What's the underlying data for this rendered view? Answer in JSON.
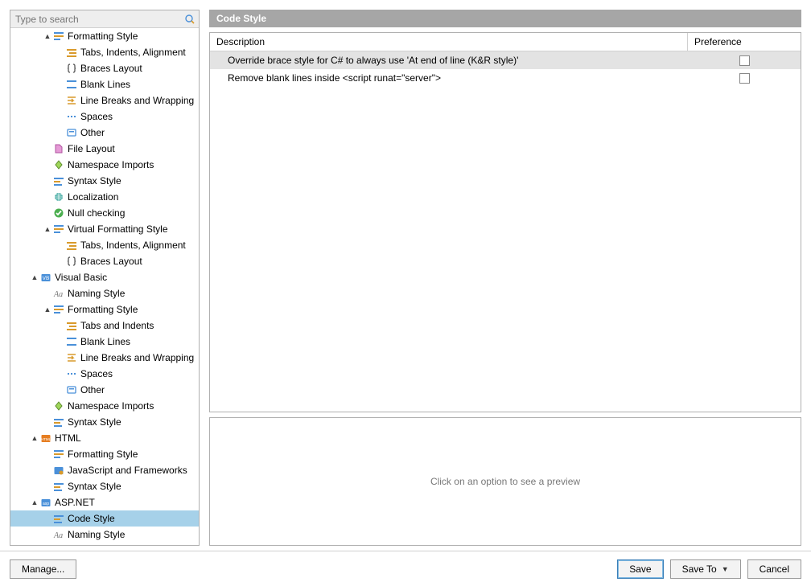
{
  "search": {
    "placeholder": "Type to search"
  },
  "tree": {
    "items": [
      {
        "depth": 2,
        "caret": "▲",
        "icon": "formattingstyle",
        "label": "Formatting Style"
      },
      {
        "depth": 3,
        "caret": "",
        "icon": "tabs",
        "label": "Tabs, Indents, Alignment"
      },
      {
        "depth": 3,
        "caret": "",
        "icon": "braces",
        "label": "Braces Layout"
      },
      {
        "depth": 3,
        "caret": "",
        "icon": "blanklines",
        "label": "Blank Lines"
      },
      {
        "depth": 3,
        "caret": "",
        "icon": "linebreaks",
        "label": "Line Breaks and Wrapping"
      },
      {
        "depth": 3,
        "caret": "",
        "icon": "spaces",
        "label": "Spaces"
      },
      {
        "depth": 3,
        "caret": "",
        "icon": "other",
        "label": "Other"
      },
      {
        "depth": 2,
        "caret": "",
        "icon": "filelayout",
        "label": "File Layout"
      },
      {
        "depth": 2,
        "caret": "",
        "icon": "namespace",
        "label": "Namespace Imports"
      },
      {
        "depth": 2,
        "caret": "",
        "icon": "syntaxstyle",
        "label": "Syntax Style"
      },
      {
        "depth": 2,
        "caret": "",
        "icon": "localization",
        "label": "Localization"
      },
      {
        "depth": 2,
        "caret": "",
        "icon": "nullcheck",
        "label": "Null checking"
      },
      {
        "depth": 2,
        "caret": "▲",
        "icon": "formattingstyle",
        "label": "Virtual Formatting Style"
      },
      {
        "depth": 3,
        "caret": "",
        "icon": "tabs",
        "label": "Tabs, Indents, Alignment"
      },
      {
        "depth": 3,
        "caret": "",
        "icon": "braces",
        "label": "Braces Layout"
      },
      {
        "depth": 1,
        "caret": "▲",
        "icon": "visualbasic",
        "label": "Visual Basic"
      },
      {
        "depth": 2,
        "caret": "",
        "icon": "naming",
        "label": "Naming Style"
      },
      {
        "depth": 2,
        "caret": "▲",
        "icon": "formattingstyle",
        "label": "Formatting Style"
      },
      {
        "depth": 3,
        "caret": "",
        "icon": "tabs",
        "label": "Tabs and Indents"
      },
      {
        "depth": 3,
        "caret": "",
        "icon": "blanklines",
        "label": "Blank Lines"
      },
      {
        "depth": 3,
        "caret": "",
        "icon": "linebreaks",
        "label": "Line Breaks and Wrapping"
      },
      {
        "depth": 3,
        "caret": "",
        "icon": "spaces",
        "label": "Spaces"
      },
      {
        "depth": 3,
        "caret": "",
        "icon": "other",
        "label": "Other"
      },
      {
        "depth": 2,
        "caret": "",
        "icon": "namespace",
        "label": "Namespace Imports"
      },
      {
        "depth": 2,
        "caret": "",
        "icon": "syntaxstyle",
        "label": "Syntax Style"
      },
      {
        "depth": 1,
        "caret": "▲",
        "icon": "html",
        "label": "HTML"
      },
      {
        "depth": 2,
        "caret": "",
        "icon": "formattingstyle",
        "label": "Formatting Style"
      },
      {
        "depth": 2,
        "caret": "",
        "icon": "jsframeworks",
        "label": "JavaScript and Frameworks"
      },
      {
        "depth": 2,
        "caret": "",
        "icon": "syntaxstyle",
        "label": "Syntax Style"
      },
      {
        "depth": 1,
        "caret": "▲",
        "icon": "aspnet",
        "label": "ASP.NET"
      },
      {
        "depth": 2,
        "caret": "",
        "icon": "codestyle",
        "label": "Code Style",
        "selected": true
      },
      {
        "depth": 2,
        "caret": "",
        "icon": "naming",
        "label": "Naming Style"
      }
    ]
  },
  "panel": {
    "title": "Code Style",
    "columns": {
      "description": "Description",
      "preference": "Preference"
    },
    "rows": [
      {
        "desc": "Override brace style for C# to always use 'At end of line (K&R style)'",
        "selected": true
      },
      {
        "desc": "Remove blank lines inside <script runat=\"server\">"
      }
    ],
    "preview_placeholder": "Click on an option to see a preview"
  },
  "footer": {
    "manage": "Manage...",
    "save": "Save",
    "saveTo": "Save To",
    "cancel": "Cancel"
  }
}
